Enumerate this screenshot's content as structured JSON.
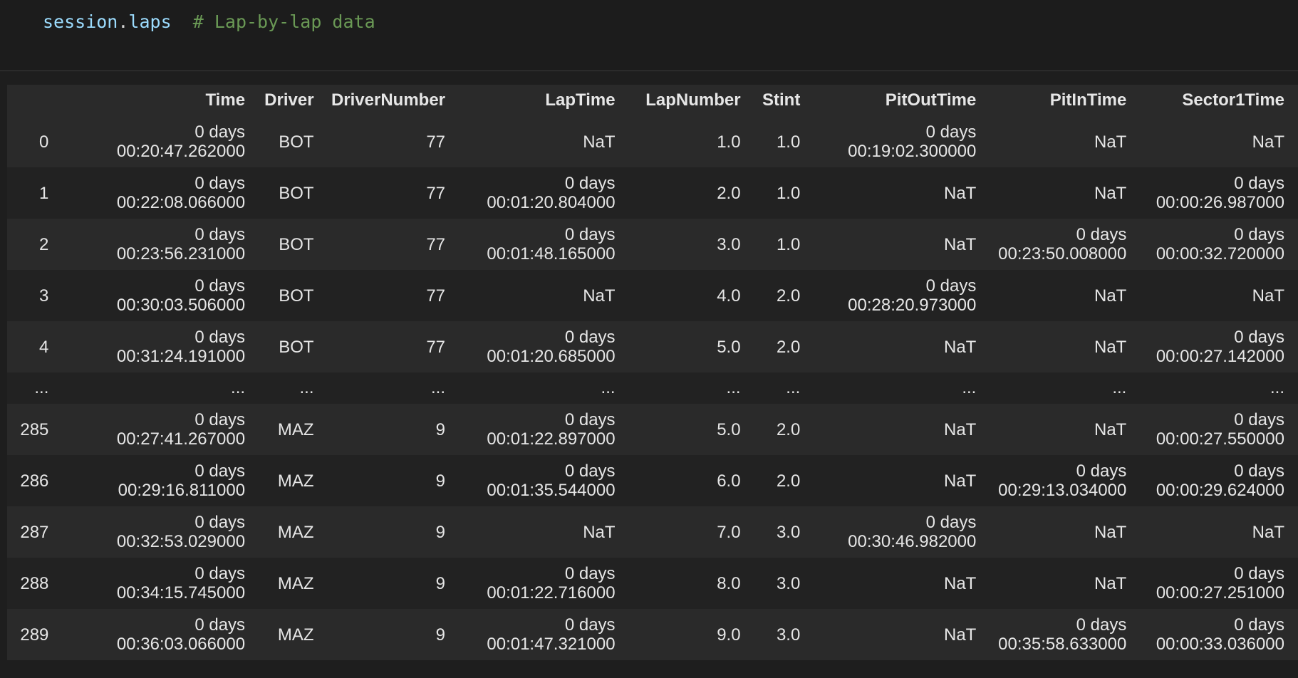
{
  "code": {
    "variable": "session",
    "dot": ".",
    "attribute": "laps",
    "comment": "# Lap-by-lap data"
  },
  "table": {
    "columns": [
      "",
      "Time",
      "Driver",
      "DriverNumber",
      "LapTime",
      "LapNumber",
      "Stint",
      "PitOutTime",
      "PitInTime",
      "Sector1Time"
    ],
    "rows": [
      {
        "cells": [
          "0",
          "0 days\n00:20:47.262000",
          "BOT",
          "77",
          "NaT",
          "1.0",
          "1.0",
          "0 days\n00:19:02.300000",
          "NaT",
          "NaT"
        ]
      },
      {
        "cells": [
          "1",
          "0 days\n00:22:08.066000",
          "BOT",
          "77",
          "0 days\n00:01:20.804000",
          "2.0",
          "1.0",
          "NaT",
          "NaT",
          "0 days\n00:00:26.987000"
        ]
      },
      {
        "cells": [
          "2",
          "0 days\n00:23:56.231000",
          "BOT",
          "77",
          "0 days\n00:01:48.165000",
          "3.0",
          "1.0",
          "NaT",
          "0 days\n00:23:50.008000",
          "0 days\n00:00:32.720000"
        ]
      },
      {
        "cells": [
          "3",
          "0 days\n00:30:03.506000",
          "BOT",
          "77",
          "NaT",
          "4.0",
          "2.0",
          "0 days\n00:28:20.973000",
          "NaT",
          "NaT"
        ]
      },
      {
        "cells": [
          "4",
          "0 days\n00:31:24.191000",
          "BOT",
          "77",
          "0 days\n00:01:20.685000",
          "5.0",
          "2.0",
          "NaT",
          "NaT",
          "0 days\n00:00:27.142000"
        ]
      },
      {
        "cells": [
          "...",
          "...",
          "...",
          "...",
          "...",
          "...",
          "...",
          "...",
          "...",
          "..."
        ]
      },
      {
        "cells": [
          "285",
          "0 days\n00:27:41.267000",
          "MAZ",
          "9",
          "0 days\n00:01:22.897000",
          "5.0",
          "2.0",
          "NaT",
          "NaT",
          "0 days\n00:00:27.550000"
        ]
      },
      {
        "cells": [
          "286",
          "0 days\n00:29:16.811000",
          "MAZ",
          "9",
          "0 days\n00:01:35.544000",
          "6.0",
          "2.0",
          "NaT",
          "0 days\n00:29:13.034000",
          "0 days\n00:00:29.624000"
        ]
      },
      {
        "cells": [
          "287",
          "0 days\n00:32:53.029000",
          "MAZ",
          "9",
          "NaT",
          "7.0",
          "3.0",
          "0 days\n00:30:46.982000",
          "NaT",
          "NaT"
        ]
      },
      {
        "cells": [
          "288",
          "0 days\n00:34:15.745000",
          "MAZ",
          "9",
          "0 days\n00:01:22.716000",
          "8.0",
          "3.0",
          "NaT",
          "NaT",
          "0 days\n00:00:27.251000"
        ]
      },
      {
        "cells": [
          "289",
          "0 days\n00:36:03.066000",
          "MAZ",
          "9",
          "0 days\n00:01:47.321000",
          "9.0",
          "3.0",
          "NaT",
          "0 days\n00:35:58.633000",
          "0 days\n00:00:33.036000"
        ]
      }
    ]
  },
  "colors": {
    "background": "#1e1e1e",
    "code_variable": "#9cdcfe",
    "code_comment": "#6a9955",
    "row_odd": "#2a2a2a",
    "row_even": "#222222",
    "text": "#e6e6e6"
  }
}
